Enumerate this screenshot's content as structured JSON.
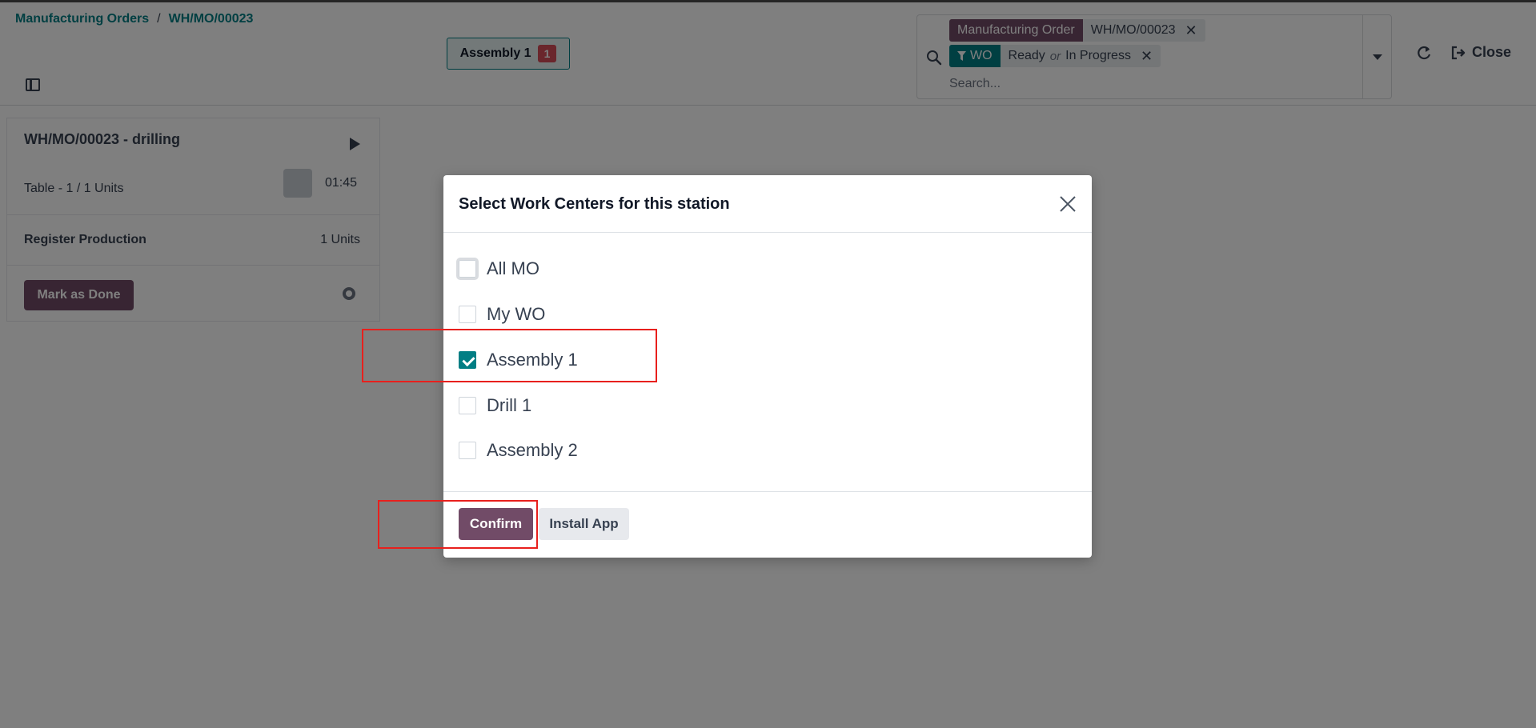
{
  "breadcrumb": {
    "parent": "Manufacturing Orders",
    "separator": "/",
    "current": "WH/MO/00023"
  },
  "workcenter_button": {
    "label": "Assembly 1",
    "count": "1"
  },
  "search": {
    "facets": [
      {
        "tag": "Manufacturing Order",
        "values": [
          "WH/MO/00023"
        ]
      },
      {
        "tag": "WO",
        "tag_icon": "filter-icon",
        "values": [
          "Ready",
          "In Progress"
        ],
        "joiner": "or"
      }
    ],
    "placeholder": "Search...",
    "remove_glyph": "✕"
  },
  "actions": {
    "close_label": "Close"
  },
  "background_card": {
    "title": "WH/MO/00023 - drilling",
    "product_line": "Table - 1 / 1 Units",
    "timer": "01:45",
    "register_label": "Register Production",
    "register_units": "1 Units",
    "done_label": "Mark as Done"
  },
  "modal": {
    "title": "Select Work Centers for this station",
    "options": [
      {
        "label": "All MO",
        "checked": false
      },
      {
        "label": "My WO",
        "checked": false
      },
      {
        "label": "Assembly 1",
        "checked": true
      },
      {
        "label": "Drill 1",
        "checked": false
      },
      {
        "label": "Assembly 2",
        "checked": false
      }
    ],
    "confirm_label": "Confirm",
    "install_label": "Install App"
  },
  "colors": {
    "brand": "#714b67",
    "accent": "#017e84",
    "badge": "#d44c59",
    "highlight": "#e8201d"
  }
}
